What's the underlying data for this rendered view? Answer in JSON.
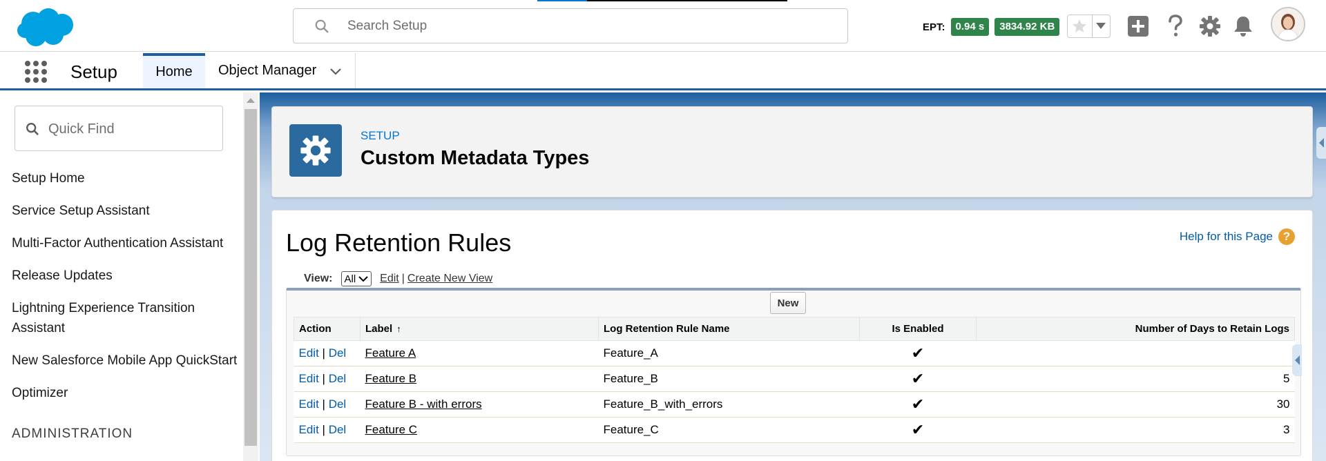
{
  "header": {
    "search_placeholder": "Search Setup",
    "ept_label": "EPT:",
    "ept_time": "0.94 s",
    "ept_size": "3834.92 KB",
    "accent_color": "#0176d3",
    "badge_color": "#2e844a"
  },
  "nav": {
    "app_name": "Setup",
    "tabs": [
      {
        "label": "Home",
        "active": true
      },
      {
        "label": "Object Manager",
        "active": false
      }
    ]
  },
  "sidebar": {
    "quick_find_placeholder": "Quick Find",
    "items": [
      {
        "label": "Setup Home"
      },
      {
        "label": "Service Setup Assistant"
      },
      {
        "label": "Multi-Factor Authentication Assistant"
      },
      {
        "label": "Release Updates"
      },
      {
        "label": "Lightning Experience Transition Assistant"
      },
      {
        "label": "New Salesforce Mobile App QuickStart"
      },
      {
        "label": "Optimizer"
      }
    ],
    "section_heading": "ADMINISTRATION"
  },
  "page_header": {
    "eyebrow": "SETUP",
    "title": "Custom Metadata Types"
  },
  "card": {
    "title": "Log Retention Rules",
    "help_link": "Help for this Page",
    "view_label": "View:",
    "view_selected": "All",
    "edit_link": "Edit",
    "separator": "|",
    "create_view_link": "Create New View",
    "new_button": "New"
  },
  "table": {
    "columns": [
      "Action",
      "Label",
      "Log Retention Rule Name",
      "Is Enabled",
      "Number of Days to Retain Logs"
    ],
    "sort_indicator": "↑",
    "edit_label": "Edit",
    "del_label": "Del",
    "action_separator": "|",
    "rows": [
      {
        "label": "Feature A",
        "name": "Feature_A",
        "enabled": "✔",
        "days": ""
      },
      {
        "label": "Feature B",
        "name": "Feature_B",
        "enabled": "✔",
        "days": "5"
      },
      {
        "label": "Feature B - with errors",
        "name": "Feature_B_with_errors",
        "enabled": "✔",
        "days": "30"
      },
      {
        "label": "Feature C",
        "name": "Feature_C",
        "enabled": "✔",
        "days": "3"
      }
    ]
  }
}
